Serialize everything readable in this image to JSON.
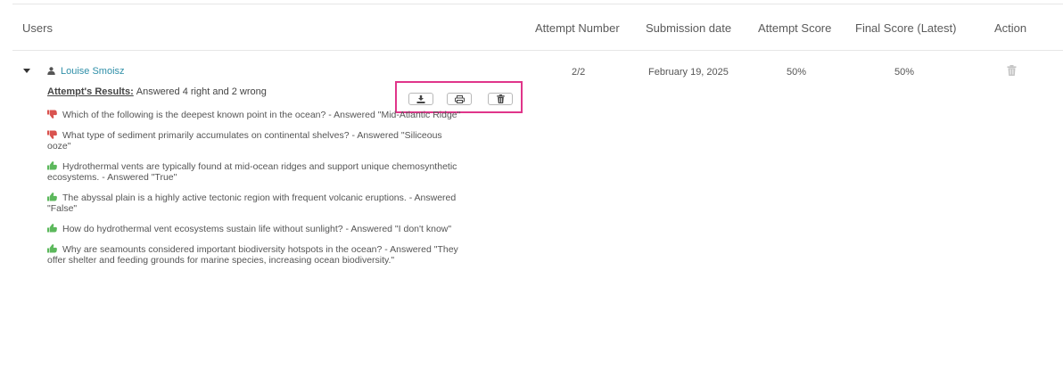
{
  "table": {
    "headers": {
      "users": "Users",
      "attempt_number": "Attempt Number",
      "submission_date": "Submission date",
      "attempt_score": "Attempt Score",
      "final_score": "Final Score (Latest)",
      "action": "Action"
    },
    "row": {
      "user_name": "Louise Smoisz",
      "attempt_number": "2/2",
      "submission_date": "February 19, 2025",
      "attempt_score": "50%",
      "final_score": "50%",
      "action_icon": "trash-icon"
    }
  },
  "results": {
    "label": "Attempt's Results:",
    "summary": "Answered 4 right and 2 wrong",
    "toolbar_icons": [
      "download-icon",
      "print-icon",
      "trash-icon"
    ],
    "highlight_color": "#e0358a",
    "answers": [
      {
        "status": "wrong",
        "icon": "thumbs-down-icon",
        "text": "Which of the following is the deepest known point in the ocean? - Answered \"Mid-Atlantic Ridge\""
      },
      {
        "status": "wrong",
        "icon": "thumbs-down-icon",
        "text": "What type of sediment primarily accumulates on continental shelves? - Answered \"Siliceous ooze\""
      },
      {
        "status": "right",
        "icon": "thumbs-up-icon",
        "text": "Hydrothermal vents are typically found at mid-ocean ridges and support unique chemosynthetic ecosystems. - Answered \"True\""
      },
      {
        "status": "right",
        "icon": "thumbs-up-icon",
        "text": "The abyssal plain is a highly active tectonic region with frequent volcanic eruptions. - Answered \"False\""
      },
      {
        "status": "right",
        "icon": "thumbs-up-icon",
        "text": "How do hydrothermal vent ecosystems sustain life without sunlight? - Answered \"I don't know\""
      },
      {
        "status": "right",
        "icon": "thumbs-up-icon",
        "text": "Why are seamounts considered important biodiversity hotspots in the ocean? - Answered \"They offer shelter and feeding grounds for marine species, increasing ocean biodiversity.\""
      }
    ]
  },
  "colors": {
    "link": "#2f8fa8",
    "wrong": "#d9534f",
    "right": "#5cb85c",
    "highlight": "#e0358a"
  }
}
